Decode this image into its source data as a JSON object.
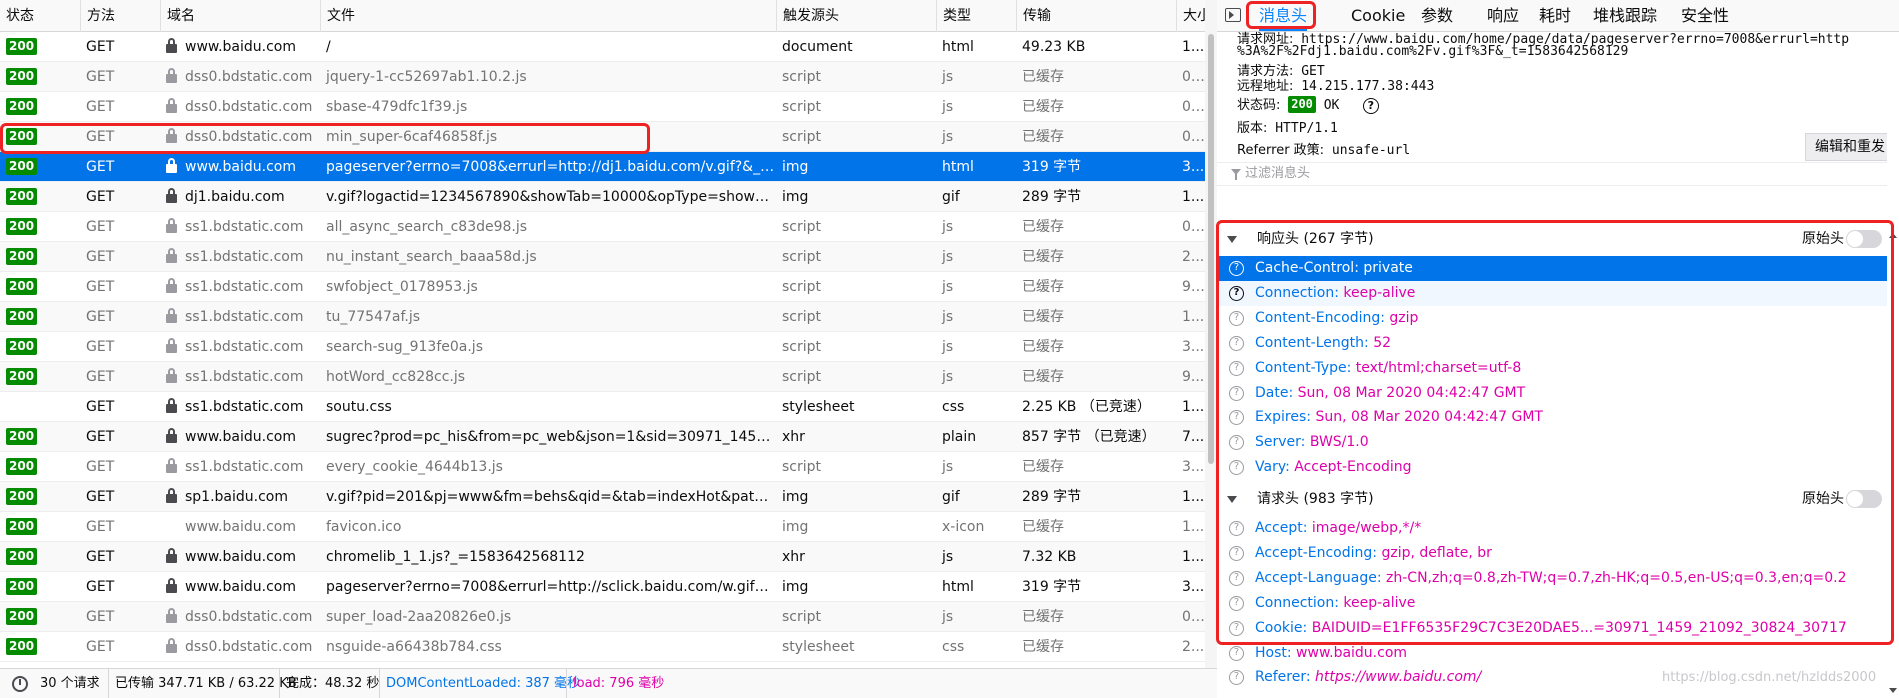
{
  "network": {
    "columns": [
      "状态",
      "方法",
      "域名",
      "文件",
      "触发源头",
      "类型",
      "传输",
      "大小"
    ],
    "rows": [
      {
        "status": "200",
        "method": "GET",
        "domain": "www.baidu.com",
        "file": "/",
        "cause": "document",
        "type": "html",
        "transfer": "49.23 KB",
        "size": "1...",
        "cached": false,
        "secure": true
      },
      {
        "status": "200",
        "method": "GET",
        "domain": "dss0.bdstatic.com",
        "file": "jquery-1-cc52697ab1.10.2.js",
        "cause": "script",
        "type": "js",
        "transfer": "已缓存",
        "size": "0 ...",
        "cached": true,
        "secure": true
      },
      {
        "status": "200",
        "method": "GET",
        "domain": "dss0.bdstatic.com",
        "file": "sbase-479dfc1f39.js",
        "cause": "script",
        "type": "js",
        "transfer": "已缓存",
        "size": "0 ...",
        "cached": true,
        "secure": true
      },
      {
        "status": "200",
        "method": "GET",
        "domain": "dss0.bdstatic.com",
        "file": "min_super-6caf46858f.js",
        "cause": "script",
        "type": "js",
        "transfer": "已缓存",
        "size": "0 ...",
        "cached": true,
        "secure": true
      },
      {
        "status": "200",
        "method": "GET",
        "domain": "www.baidu.com",
        "file": "pageserver?errno=7008&errurl=http://dj1.baidu.com/v.gif?&_t=1...",
        "cause": "img",
        "type": "html",
        "transfer": "319 字节",
        "size": "3...",
        "cached": false,
        "secure": true,
        "selected": true
      },
      {
        "status": "200",
        "method": "GET",
        "domain": "dj1.baidu.com",
        "file": "v.gif?logactid=1234567890&showTab=10000&opType=showpv&...",
        "cause": "img",
        "type": "gif",
        "transfer": "289 字节",
        "size": "1...",
        "cached": false,
        "secure": true
      },
      {
        "status": "200",
        "method": "GET",
        "domain": "ss1.bdstatic.com",
        "file": "all_async_search_c83de98.js",
        "cause": "script",
        "type": "js",
        "transfer": "已缓存",
        "size": "0 ...",
        "cached": true,
        "secure": true
      },
      {
        "status": "200",
        "method": "GET",
        "domain": "ss1.bdstatic.com",
        "file": "nu_instant_search_baaa58d.js",
        "cause": "script",
        "type": "js",
        "transfer": "已缓存",
        "size": "2...",
        "cached": true,
        "secure": true
      },
      {
        "status": "200",
        "method": "GET",
        "domain": "ss1.bdstatic.com",
        "file": "swfobject_0178953.js",
        "cause": "script",
        "type": "js",
        "transfer": "已缓存",
        "size": "9 ...",
        "cached": true,
        "secure": true
      },
      {
        "status": "200",
        "method": "GET",
        "domain": "ss1.bdstatic.com",
        "file": "tu_77547af.js",
        "cause": "script",
        "type": "js",
        "transfer": "已缓存",
        "size": "1...",
        "cached": true,
        "secure": true
      },
      {
        "status": "200",
        "method": "GET",
        "domain": "ss1.bdstatic.com",
        "file": "search-sug_913fe0a.js",
        "cause": "script",
        "type": "js",
        "transfer": "已缓存",
        "size": "3...",
        "cached": true,
        "secure": true
      },
      {
        "status": "200",
        "method": "GET",
        "domain": "ss1.bdstatic.com",
        "file": "hotWord_cc828cc.js",
        "cause": "script",
        "type": "js",
        "transfer": "已缓存",
        "size": "9...",
        "cached": true,
        "secure": true
      },
      {
        "status": "",
        "method": "GET",
        "domain": "ss1.bdstatic.com",
        "file": "soutu.css",
        "cause": "stylesheet",
        "type": "css",
        "transfer": "2.25 KB （已竞速）",
        "size": "1...",
        "cached": false,
        "secure": true
      },
      {
        "status": "200",
        "method": "GET",
        "domain": "www.baidu.com",
        "file": "sugrec?prod=pc_his&from=pc_web&json=1&sid=30971_1459_21...",
        "cause": "xhr",
        "type": "plain",
        "transfer": "857 字节 （已竞速）",
        "size": "7...",
        "cached": false,
        "secure": true
      },
      {
        "status": "200",
        "method": "GET",
        "domain": "ss1.bdstatic.com",
        "file": "every_cookie_4644b13.js",
        "cause": "script",
        "type": "js",
        "transfer": "已缓存",
        "size": "3...",
        "cached": true,
        "secure": true
      },
      {
        "status": "200",
        "method": "GET",
        "domain": "sp1.baidu.com",
        "file": "v.gif?pid=201&pj=www&fm=behs&qid=&tab=indexHot&path=h...",
        "cause": "img",
        "type": "gif",
        "transfer": "289 字节",
        "size": "1...",
        "cached": false,
        "secure": true
      },
      {
        "status": "200",
        "method": "GET",
        "domain": "www.baidu.com",
        "file": "favicon.ico",
        "cause": "img",
        "type": "x-icon",
        "transfer": "已缓存",
        "size": "1...",
        "cached": true,
        "secure": false
      },
      {
        "status": "200",
        "method": "GET",
        "domain": "www.baidu.com",
        "file": "chromelib_1_1.js?_=1583642568112",
        "cause": "xhr",
        "type": "js",
        "transfer": "7.32 KB",
        "size": "1...",
        "cached": false,
        "secure": true
      },
      {
        "status": "200",
        "method": "GET",
        "domain": "www.baidu.com",
        "file": "pageserver?errno=7008&errurl=http://sclick.baidu.com/w.gif&_t=...",
        "cause": "img",
        "type": "html",
        "transfer": "319 字节",
        "size": "3...",
        "cached": false,
        "secure": true
      },
      {
        "status": "200",
        "method": "GET",
        "domain": "dss0.bdstatic.com",
        "file": "super_load-2aa20826e0.js",
        "cause": "script",
        "type": "js",
        "transfer": "已缓存",
        "size": "0 ...",
        "cached": true,
        "secure": true
      },
      {
        "status": "200",
        "method": "GET",
        "domain": "dss0.bdstatic.com",
        "file": "nsguide-a66438b784.css",
        "cause": "stylesheet",
        "type": "css",
        "transfer": "已缓存",
        "size": "2...",
        "cached": true,
        "secure": true
      }
    ]
  },
  "statusbar": {
    "requests": "30 个请求",
    "transferred": "已传输 347.71 KB / 63.22 KB",
    "finish": "完成：48.32 秒",
    "dom": "DOMContentLoaded: 387 毫秒",
    "load": "load: 796 毫秒"
  },
  "details": {
    "tabs": [
      "消息头",
      "Cookie",
      "参数",
      "响应",
      "耗时",
      "堆栈跟踪",
      "安全性"
    ],
    "active_tab": "消息头",
    "url_label": "请求网址:",
    "url_line1": "https://www.baidu.com/home/page/data/pageserver?errno=7008&errurl=http",
    "url_line2": "%3A%2F%2Fdj1.baidu.com%2Fv.gif%3F&_t=1583642568129",
    "method_label": "请求方法:",
    "method": "GET",
    "remote_label": "远程地址:",
    "remote": "14.215.177.38:443",
    "status_label": "状态码:",
    "status_code": "200",
    "status_text": "OK",
    "version_label": "版本:",
    "version": "HTTP/1.1",
    "referrer_label": "Referrer 政策:",
    "referrer": "unsafe-url",
    "edit_resend": "编辑和重发",
    "filter_placeholder": "过滤消息头",
    "raw_label": "原始头",
    "response_section": "响应头 (267 字节)",
    "response_headers": [
      {
        "k": "Cache-Control:",
        "v": "private"
      },
      {
        "k": "Connection:",
        "v": "keep-alive"
      },
      {
        "k": "Content-Encoding:",
        "v": "gzip"
      },
      {
        "k": "Content-Length:",
        "v": "52"
      },
      {
        "k": "Content-Type:",
        "v": "text/html;charset=utf-8"
      },
      {
        "k": "Date:",
        "v": "Sun, 08 Mar 2020 04:42:47 GMT"
      },
      {
        "k": "Expires:",
        "v": "Sun, 08 Mar 2020 04:42:47 GMT"
      },
      {
        "k": "Server:",
        "v": "BWS/1.0"
      },
      {
        "k": "Vary:",
        "v": "Accept-Encoding"
      }
    ],
    "request_section": "请求头 (983 字节)",
    "request_headers": [
      {
        "k": "Accept:",
        "v": "image/webp,*/*"
      },
      {
        "k": "Accept-Encoding:",
        "v": "gzip, deflate, br"
      },
      {
        "k": "Accept-Language:",
        "v": "zh-CN,zh;q=0.8,zh-TW;q=0.7,zh-HK;q=0.5,en-US;q=0.3,en;q=0.2"
      },
      {
        "k": "Connection:",
        "v": "keep-alive"
      },
      {
        "k": "Cookie:",
        "v": "BAIDUID=E1FF6535F29C7C3E20DAE5...=30971_1459_21092_30824_30717"
      },
      {
        "k": "Host:",
        "v": "www.baidu.com"
      },
      {
        "k": "Referer:",
        "v": "https://www.baidu.com/"
      }
    ]
  },
  "watermark": "https://blog.csdn.net/hzldds2000",
  "colors": {
    "accent": "#0a84ff",
    "selected": "#0074e8",
    "ok_badge": "#058b00",
    "header_key": "#0074e8",
    "header_value": "#dd00a9",
    "annotation": "#ee2222"
  }
}
